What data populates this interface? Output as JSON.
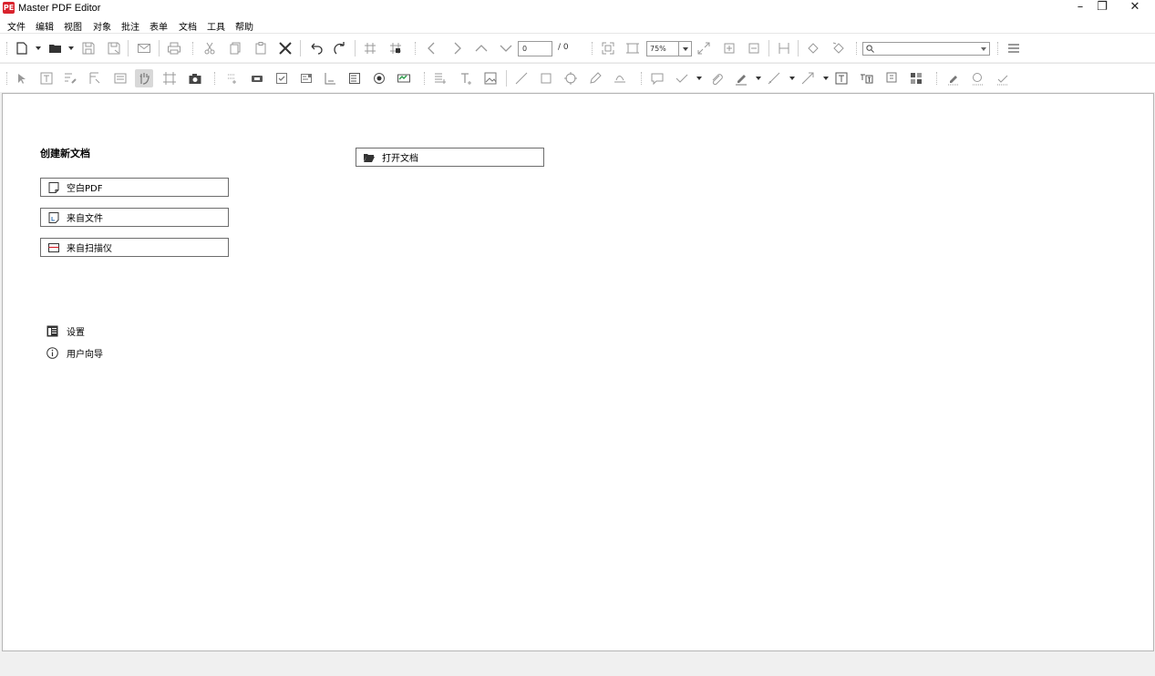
{
  "window": {
    "title": "Master PDF Editor",
    "logo_text": "PE",
    "minimize": "–",
    "restore": "❐",
    "close": "✕"
  },
  "menu": [
    "文件",
    "编辑",
    "视图",
    "对象",
    "批注",
    "表单",
    "文档",
    "工具",
    "帮助"
  ],
  "toolbar": {
    "page_current": "0",
    "page_total": "/ 0",
    "zoom": "75%",
    "search_value": ""
  },
  "start": {
    "create_title": "创建新文档",
    "blank_pdf": "空白PDF",
    "from_file": "来自文件",
    "from_scanner": "来自扫描仪",
    "open_document": "打开文档",
    "settings": "设置",
    "user_guide": "用户向导"
  },
  "colors": {
    "logo": "#d9232d",
    "scanner_icon": "#d9232d",
    "toolbar_bg": "#ffffff",
    "window_bg": "#f0f0f0"
  }
}
